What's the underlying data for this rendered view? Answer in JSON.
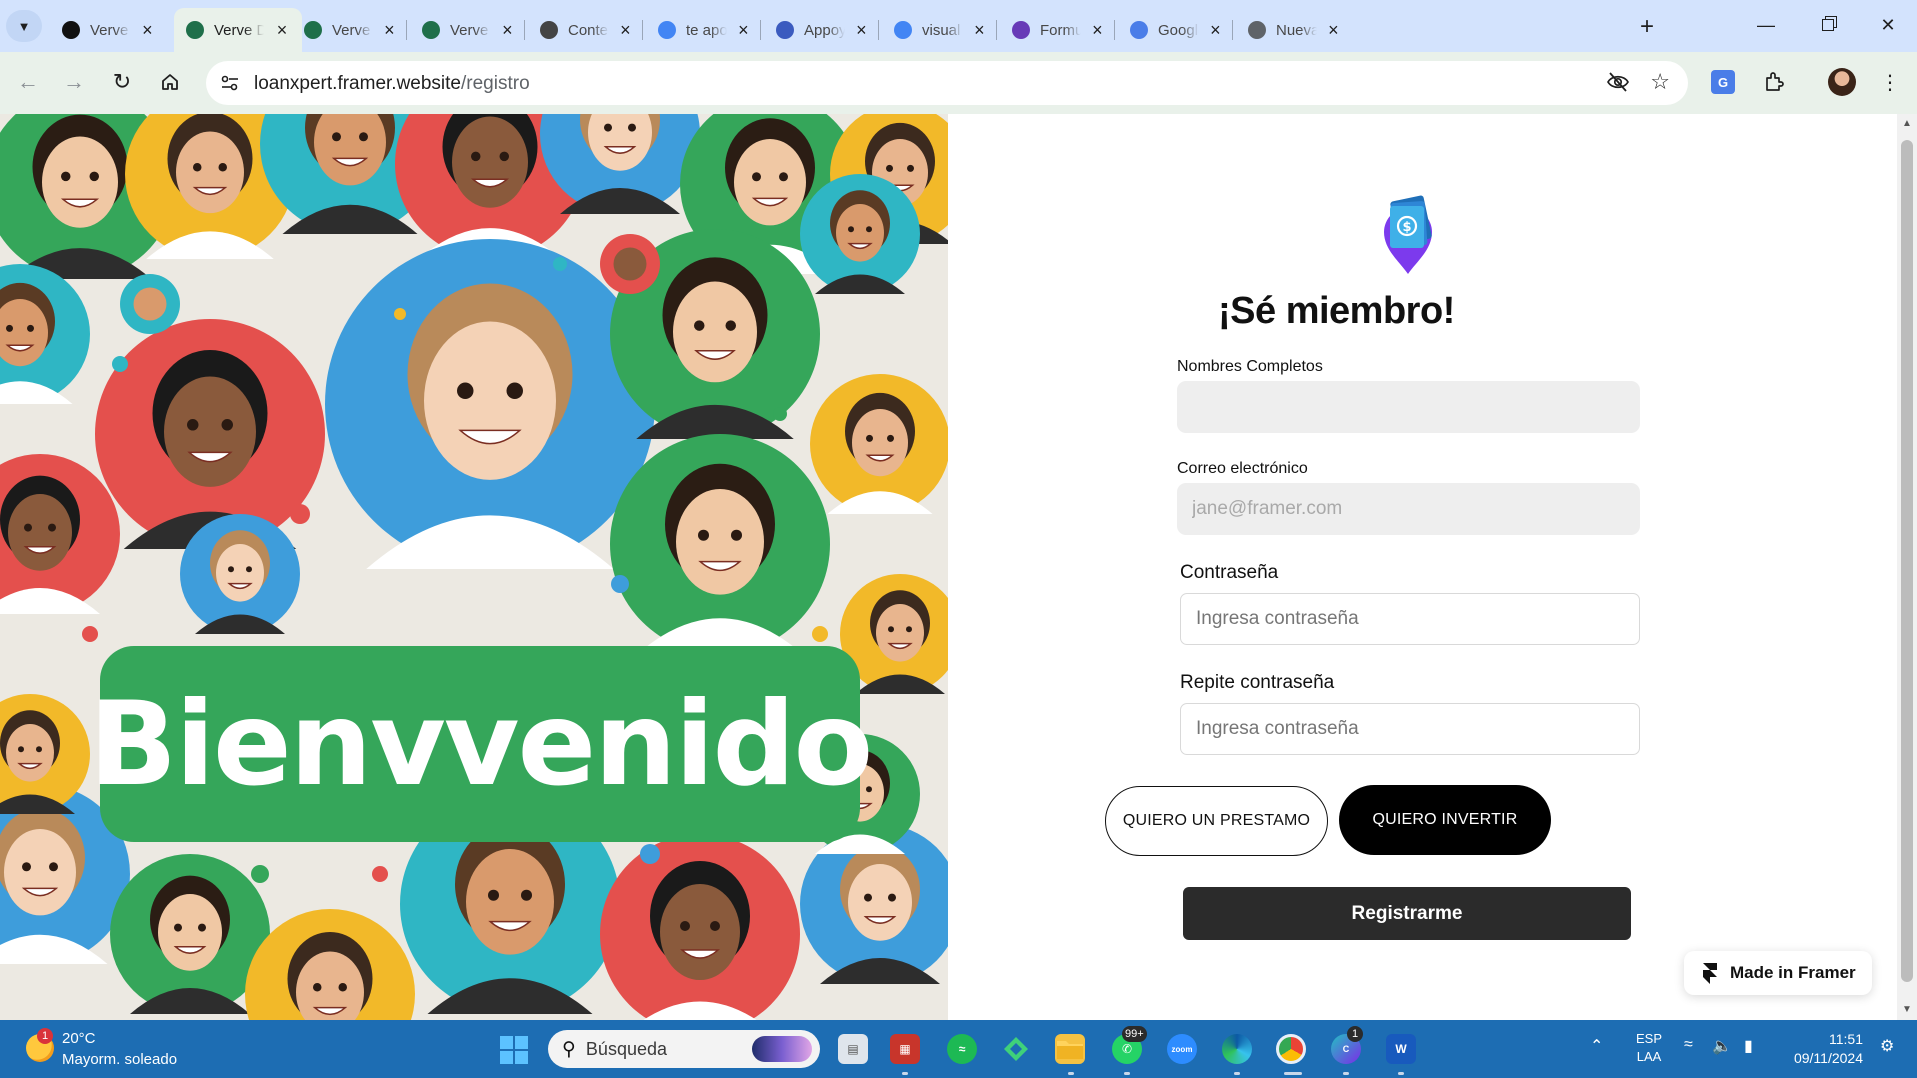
{
  "browser": {
    "tabs": [
      {
        "label": "Verve (c",
        "icon": "framer-icon",
        "color": "#111111"
      },
      {
        "label": "Verve D",
        "icon": "webflow-w-icon",
        "color": "#1f6f4a"
      },
      {
        "label": "Verve D",
        "icon": "webflow-w-icon",
        "color": "#1f6f4a"
      },
      {
        "label": "Verve D",
        "icon": "webflow-w-icon",
        "color": "#1f6f4a"
      },
      {
        "label": "Conten",
        "icon": "openai-icon",
        "color": "#444444"
      },
      {
        "label": "te apoy",
        "icon": "google-icon",
        "color": "#4285f4"
      },
      {
        "label": "Appoyi",
        "icon": "appoyi-icon",
        "color": "#3b5bbf"
      },
      {
        "label": "visual s",
        "icon": "google-icon",
        "color": "#4285f4"
      },
      {
        "label": "Formula",
        "icon": "forms-icon",
        "color": "#673ab7"
      },
      {
        "label": "Google",
        "icon": "translate-icon",
        "color": "#4a7de8"
      },
      {
        "label": "Nueva p",
        "icon": "chrome-icon",
        "color": "#5f6368"
      }
    ],
    "active_tab_index": 1,
    "url_host": "loanxpert.framer.website",
    "url_path": "/registro",
    "new_tab_symbol": "+"
  },
  "hero": {
    "banner_text": "Bienvvenido",
    "colors": {
      "green": "#35a65a",
      "yellow": "#f2b929",
      "teal": "#2fb6c4",
      "red": "#e4504d",
      "blue": "#3e9ddb",
      "bg": "#ece9e2"
    }
  },
  "form": {
    "heading": "¡Sé miembro!",
    "logo_icon": "money-pin-icon",
    "fields": {
      "full_name": {
        "label": "Nombres Completos",
        "value": "",
        "placeholder": ""
      },
      "email": {
        "label": "Correo electrónico",
        "value": "",
        "placeholder": "jane@framer.com"
      },
      "password": {
        "label": "Contraseña",
        "value": "",
        "placeholder": "Ingresa contraseña"
      },
      "password_repeat": {
        "label": "Repite contraseña",
        "value": "",
        "placeholder": "Ingresa contraseña"
      }
    },
    "choice_loan": "QUIERO UN PRESTAMO",
    "choice_invest": "QUIERO  INVERTIR",
    "submit": "Registrarme",
    "badge": "Made in Framer",
    "accent": "#7c3aed",
    "button_dark": "#2b2b2b"
  },
  "taskbar": {
    "weather_temp": "20°C",
    "weather_desc": "Mayorm. soleado",
    "weather_badge": "1",
    "search_placeholder": "Búsqueda",
    "whatsapp_badge": "99+",
    "canva_badge": "1",
    "language_top": "ESP",
    "language_bottom": "LAA",
    "time": "11:51",
    "date": "09/11/2024"
  }
}
